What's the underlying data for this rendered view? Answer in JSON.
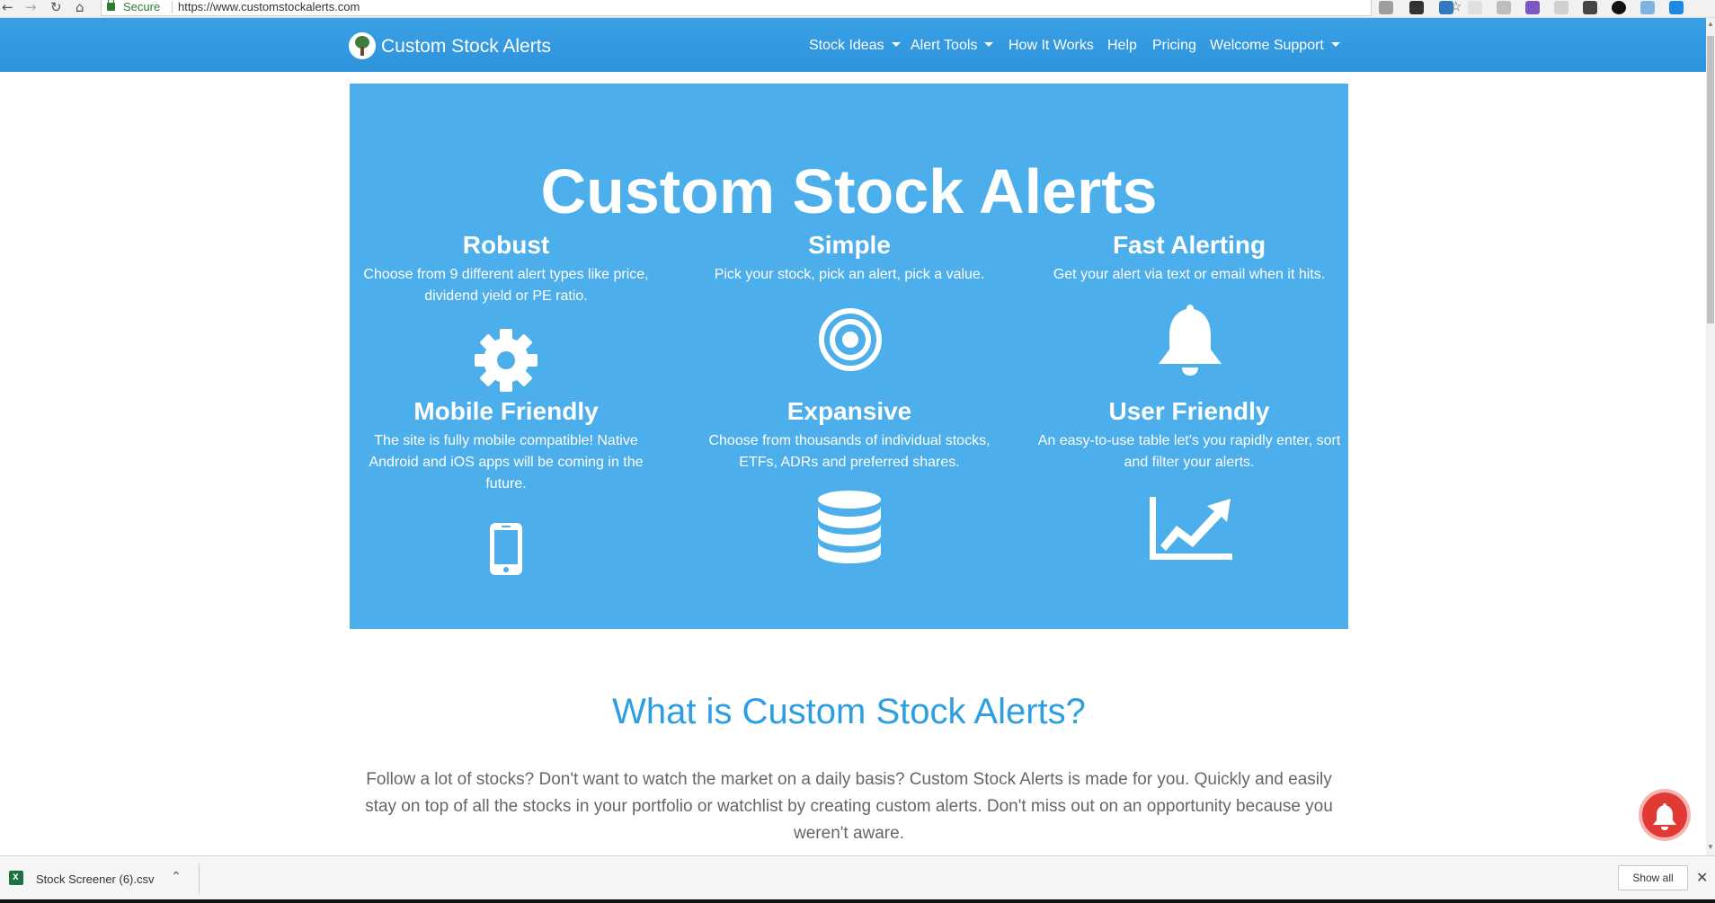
{
  "browser": {
    "secure_label": "Secure",
    "url": "https://www.customstockalerts.com",
    "nav_glyphs": {
      "back": "←",
      "forward": "→",
      "reload": "↻",
      "home": "⌂",
      "bookmark": "☆"
    }
  },
  "navbar": {
    "brand": "Custom Stock Alerts",
    "items": [
      {
        "label": "Stock Ideas",
        "dropdown": true
      },
      {
        "label": "Alert Tools",
        "dropdown": true
      },
      {
        "label": "How It Works",
        "dropdown": false
      },
      {
        "label": "Help",
        "dropdown": false
      },
      {
        "label": "Pricing",
        "dropdown": false
      },
      {
        "label": "Welcome Support",
        "dropdown": true
      }
    ]
  },
  "hero": {
    "title": "Custom Stock Alerts",
    "features": [
      {
        "title": "Robust",
        "text": "Choose from 9 different alert types like price, dividend yield or PE ratio.",
        "icon": "gear-icon"
      },
      {
        "title": "Simple",
        "text": "Pick your stock, pick an alert, pick a value.",
        "icon": "target-icon"
      },
      {
        "title": "Fast Alerting",
        "text": "Get your alert via text or email when it hits.",
        "icon": "bell-icon"
      },
      {
        "title": "Mobile Friendly",
        "text": "The site is fully mobile compatible! Native Android and iOS apps will be coming in the future.",
        "icon": "mobile-phone-icon"
      },
      {
        "title": "Expansive",
        "text": "Choose from thousands of individual stocks, ETFs, ADRs and preferred shares.",
        "icon": "database-icon"
      },
      {
        "title": "User Friendly",
        "text": "An easy-to-use table let's you rapidly enter, sort and filter your alerts.",
        "icon": "line-chart-icon"
      }
    ]
  },
  "about": {
    "title": "What is Custom Stock Alerts?",
    "body": "Follow a lot of stocks? Don't want to watch the market on a daily basis? Custom Stock Alerts is made for you. Quickly and easily stay on top of all the stocks in your portfolio or watchlist by creating custom alerts. Don't miss out on an opportunity because you weren't aware."
  },
  "downloads": {
    "file_name": "Stock Screener (6).csv",
    "show_all": "Show all"
  },
  "colors": {
    "navbar": "#2d93db",
    "hero": "#4caeea",
    "heading": "#2e9ee3",
    "notification": "#e13a34"
  }
}
